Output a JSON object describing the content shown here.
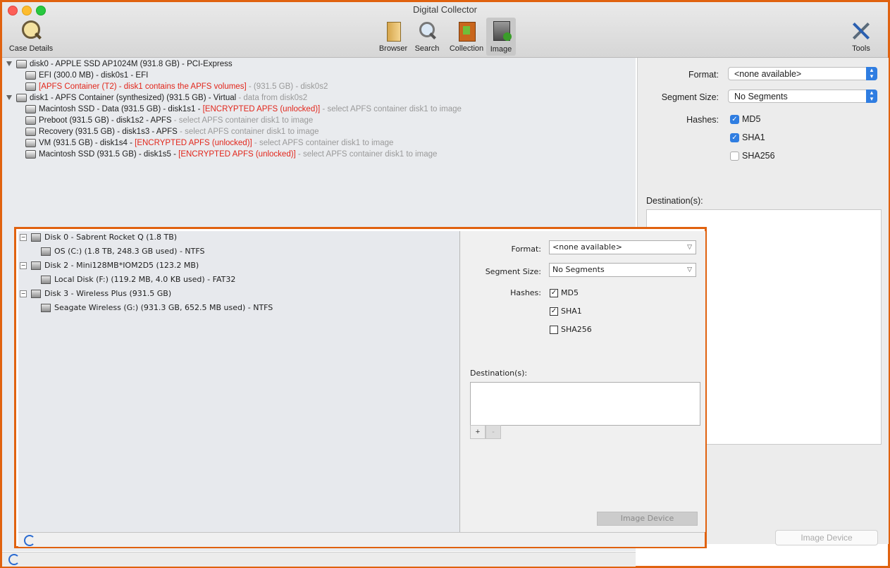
{
  "window": {
    "title": "Digital Collector"
  },
  "toolbar": {
    "case_details": "Case Details",
    "browser": "Browser",
    "search": "Search",
    "collection": "Collection",
    "image": "Image",
    "tools": "Tools"
  },
  "mac_tree": [
    {
      "main": "disk0 - APPLE SSD AP1024M (931.8 GB) - PCI-Express",
      "red": "",
      "gray": ""
    },
    {
      "main": "EFI (300.0 MB) - disk0s1 - EFI",
      "red": "",
      "gray": ""
    },
    {
      "main": "",
      "red": "[APFS Container (T2) - disk1 contains the APFS volumes]",
      "gray": " -  (931.5 GB) - disk0s2"
    },
    {
      "main": "disk1 - APFS Container (synthesized) (931.5 GB) - Virtual",
      "red": "",
      "gray": " - data from disk0s2"
    },
    {
      "main": "Macintosh SSD - Data (931.5 GB) - disk1s1 - ",
      "red": " [ENCRYPTED APFS (unlocked)]",
      "gray": " - select APFS container disk1 to image"
    },
    {
      "main": "Preboot (931.5 GB) - disk1s2 - APFS",
      "red": "",
      "gray": "  - select APFS container disk1 to image"
    },
    {
      "main": "Recovery (931.5 GB) - disk1s3 - APFS",
      "red": "",
      "gray": "  - select APFS container disk1 to image"
    },
    {
      "main": "VM (931.5 GB) - disk1s4 - ",
      "red": " [ENCRYPTED APFS (unlocked)]",
      "gray": " - select APFS container disk1 to image"
    },
    {
      "main": "Macintosh SSD (931.5 GB) - disk1s5 - ",
      "red": " [ENCRYPTED APFS (unlocked)]",
      "gray": " - select APFS container disk1 to image"
    }
  ],
  "mac_panel": {
    "format_label": "Format:",
    "format_value": "<none available>",
    "segment_label": "Segment Size:",
    "segment_value": "No Segments",
    "hashes_label": "Hashes:",
    "md5": "MD5",
    "sha1": "SHA1",
    "sha256": "SHA256",
    "destination_label": "Destination(s):",
    "image_device": "Image Device"
  },
  "win_tree": [
    {
      "label": "Disk 0 - Sabrent Rocket Q (1.8 TB)"
    },
    {
      "label": "OS (C:) (1.8 TB, 248.3 GB used) - NTFS"
    },
    {
      "label": "Disk 2 - Mini128MB*IOM2D5 (123.2 MB)"
    },
    {
      "label": "Local Disk (F:) (119.2 MB, 4.0 KB used) - FAT32"
    },
    {
      "label": "Disk 3 - Wireless Plus (931.5 GB)"
    },
    {
      "label": "Seagate Wireless (G:) (931.3 GB, 652.5 MB used) - NTFS"
    }
  ],
  "win_panel": {
    "format_label": "Format:",
    "format_value": "<none available>",
    "segment_label": "Segment Size:",
    "segment_value": "No Segments",
    "hashes_label": "Hashes:",
    "md5": "MD5",
    "sha1": "SHA1",
    "sha256": "SHA256",
    "destination_label": "Destination(s):",
    "add": "+",
    "remove": "-",
    "image_device": "Image Device"
  },
  "colors": {
    "highlight": "#e0620f",
    "encrypted_red": "#e2261b",
    "mac_accent": "#2f7de1"
  }
}
